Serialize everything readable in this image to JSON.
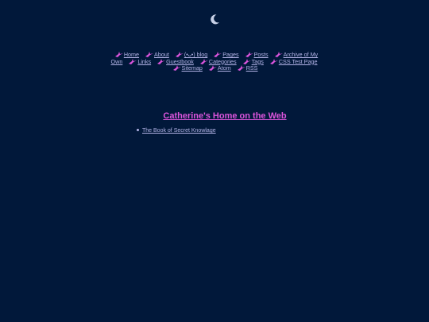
{
  "nav": {
    "items": [
      {
        "label": "Home"
      },
      {
        "label": "About"
      },
      {
        "label": "(•ᴗ•) blog"
      },
      {
        "label": "Pages"
      },
      {
        "label": "Posts"
      },
      {
        "label": "Archive of My Own"
      },
      {
        "label": "Links"
      },
      {
        "label": "Guestbook"
      },
      {
        "label": "Categories"
      },
      {
        "label": "Tags"
      },
      {
        "label": "CSS Test Page"
      },
      {
        "label": "Sitemap"
      },
      {
        "label": "Atom"
      },
      {
        "label": "RSS"
      }
    ]
  },
  "page": {
    "title": "Catherine's Home on the Web"
  },
  "links": [
    {
      "label": "The Book of Secret Knowlage"
    }
  ],
  "colors": {
    "background": "#01183a",
    "accent": "#dd55dd",
    "link": "#b3b3e6"
  }
}
